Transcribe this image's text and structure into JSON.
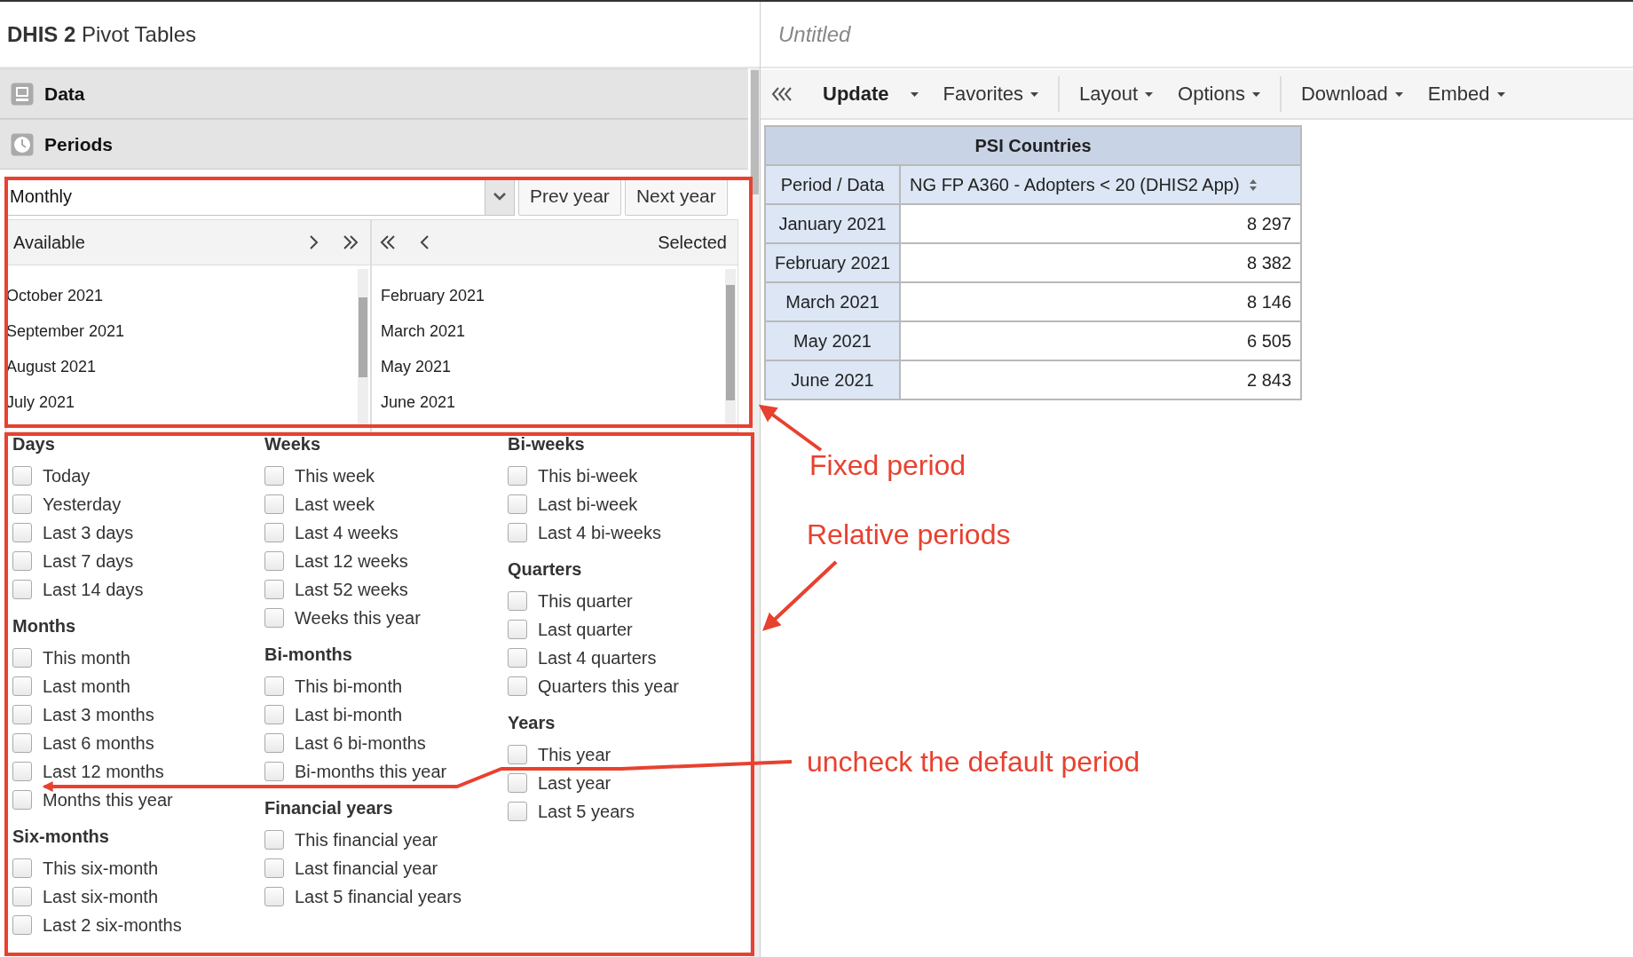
{
  "app_title": "**DHIS 2** Pivot Tables",
  "report_title": "Untitled",
  "accordion": [
    {
      "label": "Data"
    },
    {
      "label": "Periods"
    }
  ],
  "period_type": {
    "value": "Monthly"
  },
  "year_buttons": [
    "Prev year",
    "Next year"
  ],
  "available": {
    "label": "Available",
    "items": [
      "October 2021",
      "September 2021",
      "August 2021",
      "July 2021"
    ]
  },
  "selected_list": {
    "label": "Selected",
    "items": [
      "February 2021",
      "March 2021",
      "May 2021",
      "June 2021"
    ]
  },
  "relative_periods": [
    {
      "groups": [
        {
          "title": "Days",
          "items": [
            {
              "label": "Today",
              "checked": false
            },
            {
              "label": "Yesterday",
              "checked": false
            },
            {
              "label": "Last 3 days",
              "checked": false
            },
            {
              "label": "Last 7 days",
              "checked": false
            },
            {
              "label": "Last 14 days",
              "checked": false
            }
          ]
        },
        {
          "title": "Months",
          "items": [
            {
              "label": "This month",
              "checked": false
            },
            {
              "label": "Last month",
              "checked": false
            },
            {
              "label": "Last 3 months",
              "checked": false
            },
            {
              "label": "Last 6 months",
              "checked": false
            },
            {
              "label": "Last 12 months",
              "checked": false
            },
            {
              "label": "Months this year",
              "checked": false
            }
          ]
        },
        {
          "title": "Six-months",
          "items": [
            {
              "label": "This six-month",
              "checked": false
            },
            {
              "label": "Last six-month",
              "checked": false
            },
            {
              "label": "Last 2 six-months",
              "checked": false
            }
          ]
        }
      ]
    },
    {
      "groups": [
        {
          "title": "Weeks",
          "items": [
            {
              "label": "This week",
              "checked": false
            },
            {
              "label": "Last week",
              "checked": false
            },
            {
              "label": "Last 4 weeks",
              "checked": false
            },
            {
              "label": "Last 12 weeks",
              "checked": false
            },
            {
              "label": "Last 52 weeks",
              "checked": false
            },
            {
              "label": "Weeks this year",
              "checked": false
            }
          ]
        },
        {
          "title": "Bi-months",
          "items": [
            {
              "label": "This bi-month",
              "checked": false
            },
            {
              "label": "Last bi-month",
              "checked": false
            },
            {
              "label": "Last 6 bi-months",
              "checked": false
            },
            {
              "label": "Bi-months this year",
              "checked": false
            }
          ]
        },
        {
          "title": "Financial years",
          "items": [
            {
              "label": "This financial year",
              "checked": false
            },
            {
              "label": "Last financial year",
              "checked": false
            },
            {
              "label": "Last 5 financial years",
              "checked": false
            }
          ]
        }
      ]
    },
    {
      "groups": [
        {
          "title": "Bi-weeks",
          "items": [
            {
              "label": "This bi-week",
              "checked": false
            },
            {
              "label": "Last bi-week",
              "checked": false
            },
            {
              "label": "Last 4 bi-weeks",
              "checked": false
            }
          ]
        },
        {
          "title": "Quarters",
          "items": [
            {
              "label": "This quarter",
              "checked": false
            },
            {
              "label": "Last quarter",
              "checked": false
            },
            {
              "label": "Last 4 quarters",
              "checked": false
            },
            {
              "label": "Quarters this year",
              "checked": false
            }
          ]
        },
        {
          "title": "Years",
          "items": [
            {
              "label": "This year",
              "checked": false
            },
            {
              "label": "Last year",
              "checked": false
            },
            {
              "label": "Last 5 years",
              "checked": false
            }
          ]
        }
      ]
    }
  ],
  "toolbar": [
    [
      {
        "label": "Update",
        "kind": "primary"
      },
      {
        "label": "Favorites",
        "kind": "menu"
      }
    ],
    [
      {
        "label": "Layout",
        "kind": "menu"
      },
      {
        "label": "Options",
        "kind": "menu"
      }
    ],
    [
      {
        "label": "Download",
        "kind": "menu"
      },
      {
        "label": "Embed",
        "kind": "menu"
      }
    ]
  ],
  "table": {
    "title": "PSI Countries",
    "corner": "Period / Data",
    "column": "NG FP A360 - Adopters < 20 (DHIS2 App)",
    "rows": [
      {
        "period": "January 2021",
        "value": "8 297"
      },
      {
        "period": "February 2021",
        "value": "8 382"
      },
      {
        "period": "March 2021",
        "value": "8 146"
      },
      {
        "period": "May 2021",
        "value": "6 505"
      },
      {
        "period": "June 2021",
        "value": "2 843"
      }
    ]
  },
  "annotations": [
    {
      "text": "Fixed period",
      "color": "#e8412f"
    },
    {
      "text": "Relative periods",
      "color": "#e8412f"
    },
    {
      "text": "uncheck the default period",
      "color": "#e8412f"
    }
  ]
}
